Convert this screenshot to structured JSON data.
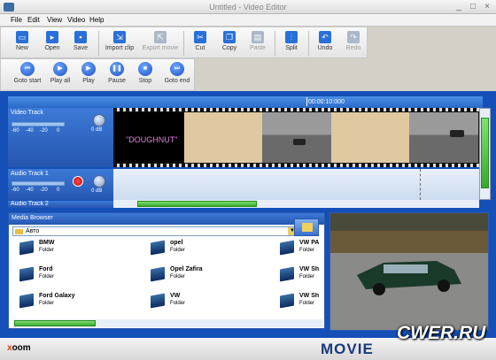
{
  "window": {
    "title": "Untitled - Video Editor",
    "minimize": "_",
    "maximize": "□",
    "close": "×"
  },
  "menu": [
    "File",
    "Edit",
    "View",
    "Video",
    "Help"
  ],
  "toolbar": [
    {
      "label": "New",
      "icon": "new-file-icon",
      "enabled": true
    },
    {
      "label": "Open",
      "icon": "open-folder-icon",
      "enabled": true
    },
    {
      "label": "Save",
      "icon": "save-disk-icon",
      "enabled": true
    },
    {
      "label": "Import clip",
      "icon": "import-clip-icon",
      "enabled": true
    },
    {
      "label": "Export movie",
      "icon": "export-movie-icon",
      "enabled": false
    },
    {
      "label": "Cut",
      "icon": "scissors-icon",
      "enabled": true
    },
    {
      "label": "Copy",
      "icon": "copy-icon",
      "enabled": true
    },
    {
      "label": "Paste",
      "icon": "paste-icon",
      "enabled": false
    },
    {
      "label": "Split",
      "icon": "split-icon",
      "enabled": true
    },
    {
      "label": "Undo",
      "icon": "undo-arrow-icon",
      "enabled": true
    },
    {
      "label": "Redo",
      "icon": "redo-arrow-icon",
      "enabled": false
    }
  ],
  "playback": [
    {
      "label": "Goto start",
      "icon": "skip-start-icon",
      "glyph": "⏮"
    },
    {
      "label": "Play all",
      "icon": "play-all-icon",
      "glyph": "▶"
    },
    {
      "label": "Play",
      "icon": "play-icon",
      "glyph": "▶"
    },
    {
      "label": "Pause",
      "icon": "pause-icon",
      "glyph": "❚❚"
    },
    {
      "label": "Stop",
      "icon": "stop-icon",
      "glyph": "■"
    },
    {
      "label": "Goto end",
      "icon": "skip-end-icon",
      "glyph": "⏭"
    }
  ],
  "timeline": {
    "timecode": "00:00:10:000",
    "tracks": [
      {
        "name": "Video Track",
        "scale": [
          "-60",
          "-40",
          "-20",
          "0"
        ],
        "db": "0 dB"
      },
      {
        "name": "Audio Track 1",
        "scale": [
          "-60",
          "-40",
          "-20",
          "0"
        ],
        "db": "0 dB"
      },
      {
        "name": "Audio Track 2"
      }
    ],
    "title_clip_text": "\"DOUGHNUT\""
  },
  "media_browser": {
    "title": "Media Browser",
    "path": "Авто",
    "items": [
      {
        "name": "BMW",
        "type": "Folder"
      },
      {
        "name": "opel",
        "type": "Folder"
      },
      {
        "name": "VW PA",
        "type": "Folder"
      },
      {
        "name": "Ford",
        "type": "Folder"
      },
      {
        "name": "Opel Zafira",
        "type": "Folder"
      },
      {
        "name": "VW Sh",
        "type": "Folder"
      },
      {
        "name": "Ford Galaxy",
        "type": "Folder"
      },
      {
        "name": "VW",
        "type": "Folder"
      },
      {
        "name": "VW Sh",
        "type": "Folder"
      }
    ]
  },
  "footer": {
    "logo_x": "x",
    "logo_rest": "oom",
    "movie_text": "MOVIE",
    "watermark": "CWER.RU"
  }
}
